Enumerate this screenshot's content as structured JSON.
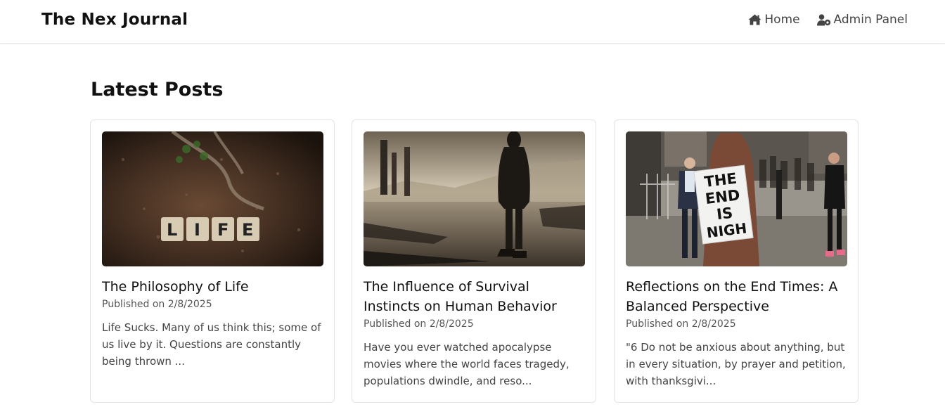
{
  "nav": {
    "brand": "The Nex Journal",
    "links": [
      {
        "label": "Home",
        "icon": "home-icon"
      },
      {
        "label": "Admin Panel",
        "icon": "user-cog-icon"
      }
    ]
  },
  "main": {
    "heading": "Latest Posts",
    "posts": [
      {
        "title": "The Philosophy of Life",
        "date": "Published on 2/8/2025",
        "excerpt": "Life Sucks. Many of us think this; some of us live by it. Questions are constantly being thrown ...",
        "image": {
          "tiles": [
            "L",
            "I",
            "F",
            "E"
          ]
        }
      },
      {
        "title": "The Influence of Survival Instincts on Human Behavior",
        "date": "Published on 2/8/2025",
        "excerpt": "Have you ever watched apocalypse movies where the world faces tragedy, populations dwindle, and reso...",
        "image": {}
      },
      {
        "title": "Reflections on the End Times: A Balanced Perspective",
        "date": "Published on 2/8/2025",
        "excerpt": "\"6 Do not be anxious about anything, but in every situation, by prayer and petition, with thanksgivi...",
        "image": {
          "sign": [
            "THE",
            "END",
            "IS",
            "NIGH"
          ]
        }
      }
    ]
  },
  "colors": {
    "text": "#111111",
    "muted": "#555555",
    "border": "#e3e3e3"
  }
}
